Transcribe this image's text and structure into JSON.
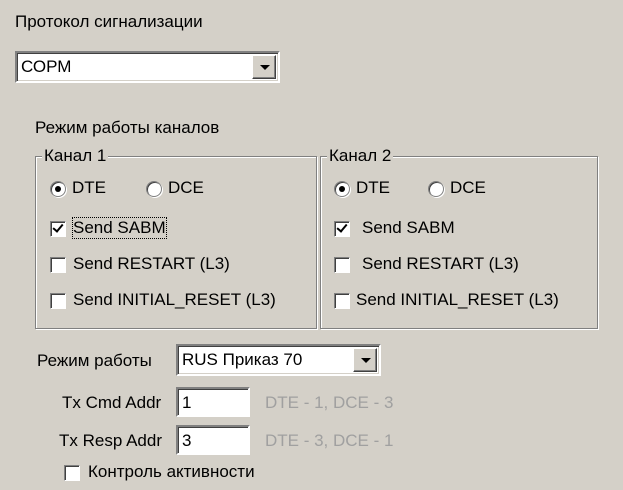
{
  "protocol": {
    "label": "Протокол сигнализации",
    "value": "СОРМ"
  },
  "channels_mode": {
    "label": "Режим работы каналов",
    "channel1": {
      "title": "Канал 1",
      "dte_label": "DTE",
      "dce_label": "DCE",
      "selected": "DTE",
      "send_sabm": {
        "label": "Send SABM",
        "checked": true
      },
      "send_restart": {
        "label": "Send RESTART (L3)",
        "checked": false
      },
      "send_initial_reset": {
        "label": "Send INITIAL_RESET (L3)",
        "checked": false
      }
    },
    "channel2": {
      "title": "Канал 2",
      "dte_label": "DTE",
      "dce_label": "DCE",
      "selected": "DTE",
      "send_sabm": {
        "label": "Send SABM",
        "checked": true
      },
      "send_restart": {
        "label": "Send RESTART (L3)",
        "checked": false
      },
      "send_initial_reset": {
        "label": "Send INITIAL_RESET (L3)",
        "checked": false
      }
    }
  },
  "mode": {
    "label": "Режим работы",
    "value": "RUS Приказ 70"
  },
  "tx_cmd": {
    "label": "Tx Cmd Addr",
    "value": "1",
    "hint": "DTE - 1,  DCE - 3"
  },
  "tx_resp": {
    "label": "Tx Resp Addr",
    "value": "3",
    "hint": "DTE - 3,  DCE - 1"
  },
  "activity": {
    "label": "Контроль активности",
    "checked": false
  }
}
